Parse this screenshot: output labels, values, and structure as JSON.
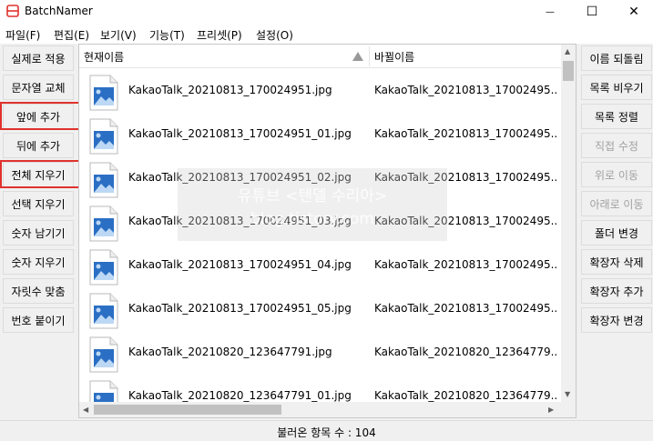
{
  "window": {
    "title": "BatchNamer",
    "minimize_glyph": "—",
    "maximize_glyph": "☐",
    "close_glyph": "✕",
    "accent_color": "#e0322e"
  },
  "menu": [
    {
      "label": "파일(F)"
    },
    {
      "label": "편집(E)"
    },
    {
      "label": "보기(V)"
    },
    {
      "label": "기능(T)"
    },
    {
      "label": "프리셋(P)"
    },
    {
      "label": "설정(O)"
    }
  ],
  "left_buttons": [
    {
      "label": "실제로 적용",
      "enabled": true,
      "highlighted": false
    },
    {
      "label": "문자열 교체",
      "enabled": true,
      "highlighted": false
    },
    {
      "label": "앞에 추가",
      "enabled": true,
      "highlighted": true
    },
    {
      "label": "뒤에 추가",
      "enabled": true,
      "highlighted": false
    },
    {
      "label": "전체 지우기",
      "enabled": true,
      "highlighted": true
    },
    {
      "label": "선택 지우기",
      "enabled": true,
      "highlighted": false
    },
    {
      "label": "숫자 남기기",
      "enabled": true,
      "highlighted": false
    },
    {
      "label": "숫자 지우기",
      "enabled": true,
      "highlighted": false
    },
    {
      "label": "자릿수 맞춤",
      "enabled": true,
      "highlighted": false
    },
    {
      "label": "번호 붙이기",
      "enabled": true,
      "highlighted": false
    }
  ],
  "right_buttons": [
    {
      "label": "이름 되돌림",
      "enabled": true
    },
    {
      "label": "목록 비우기",
      "enabled": true
    },
    {
      "label": "목록 정렬",
      "enabled": true
    },
    {
      "label": "직접 수정",
      "enabled": false
    },
    {
      "label": "위로 이동",
      "enabled": false
    },
    {
      "label": "아래로 이동",
      "enabled": false
    },
    {
      "label": "폴더 변경",
      "enabled": true
    },
    {
      "label": "확장자 삭제",
      "enabled": true
    },
    {
      "label": "확장자 추가",
      "enabled": true
    },
    {
      "label": "확장자 변경",
      "enabled": true
    }
  ],
  "list": {
    "columns": {
      "current": "현재이름",
      "new": "바뀔이름"
    },
    "sort_indicator": "ascending",
    "rows": [
      {
        "current": "KakaoTalk_20210813_170024951.jpg",
        "new": "KakaoTalk_20210813_17002495..."
      },
      {
        "current": "KakaoTalk_20210813_170024951_01.jpg",
        "new": "KakaoTalk_20210813_17002495..."
      },
      {
        "current": "KakaoTalk_20210813_170024951_02.jpg",
        "new": "KakaoTalk_20210813_17002495..."
      },
      {
        "current": "KakaoTalk_20210813_170024951_03.jpg",
        "new": "KakaoTalk_20210813_17002495..."
      },
      {
        "current": "KakaoTalk_20210813_170024951_04.jpg",
        "new": "KakaoTalk_20210813_17002495..."
      },
      {
        "current": "KakaoTalk_20210813_170024951_05.jpg",
        "new": "KakaoTalk_20210813_17002495..."
      },
      {
        "current": "KakaoTalk_20210820_123647791.jpg",
        "new": "KakaoTalk_20210820_12364779..."
      },
      {
        "current": "KakaoTalk_20210820_123647791_01.jpg",
        "new": "KakaoTalk_20210820_12364779..."
      }
    ]
  },
  "watermark": {
    "line1": "유튜브 <텐델 수리아>",
    "line2": "blog.tistory.com"
  },
  "status": {
    "text": "불러온 항목 수 : 104"
  }
}
